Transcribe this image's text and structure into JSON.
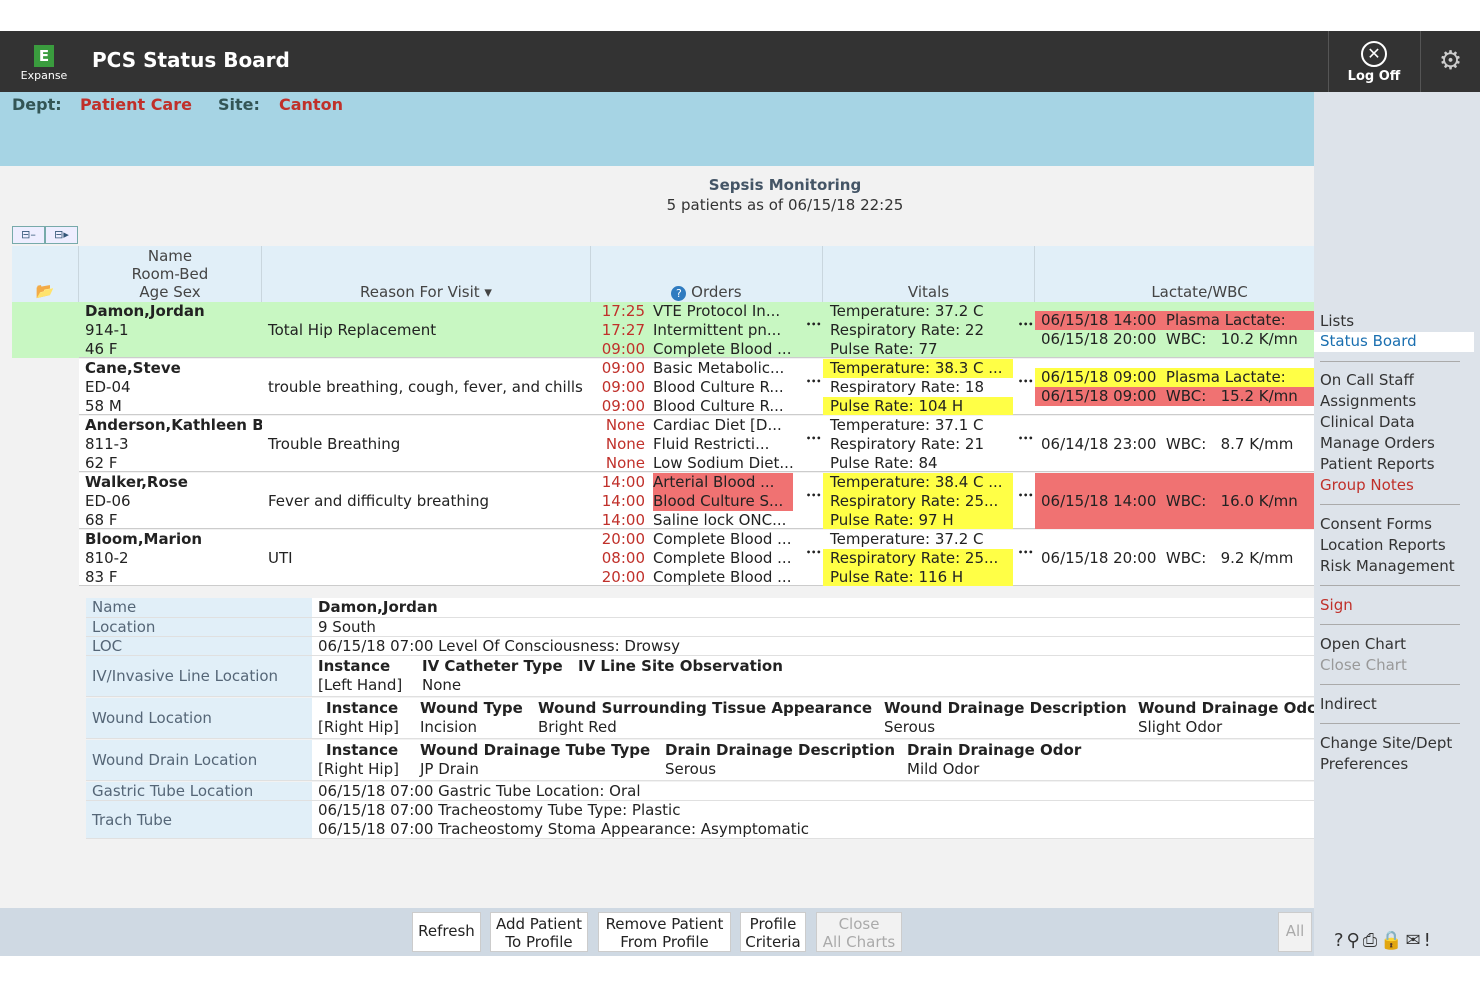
{
  "app": {
    "logo_label": "Expanse",
    "logo_letter": "E",
    "title": "PCS Status Board",
    "logoff_label": "Log Off"
  },
  "dept": {
    "dept_label": "Dept:",
    "dept_value": "Patient Care",
    "site_label": "Site:",
    "site_value": "Canton"
  },
  "board": {
    "title": "Sepsis Monitoring",
    "subtitle": "5 patients as of 06/15/18 22:25"
  },
  "columns": {
    "name_l1": "Name",
    "name_l2": "Room-Bed",
    "name_l3": "Age Sex",
    "reason": "Reason For Visit",
    "orders": "Orders",
    "vitals": "Vitals",
    "lactate": "Lactate/WBC"
  },
  "patients": [
    {
      "name": "Damon,Jordan",
      "room": "914-1",
      "agesex": "46 F",
      "reason": "Total Hip Replacement",
      "orders": [
        {
          "t": "17:25",
          "o": "VTE Protocol In..."
        },
        {
          "t": "17:27",
          "o": "Intermittent pn..."
        },
        {
          "t": "09:00",
          "o": "Complete Blood ..."
        }
      ],
      "vitals": [
        "Temperature: 37.2 C",
        "Respiratory Rate: 22",
        "Pulse Rate: 77"
      ],
      "labs": [
        "06/15/18 14:00  Plasma Lactate:",
        "06/15/18 20:00  WBC:   10.2 K/mn"
      ]
    },
    {
      "name": "Cane,Steve",
      "room": "ED-04",
      "agesex": "58 M",
      "reason": "trouble breathing, cough, fever, and chills",
      "orders": [
        {
          "t": "09:00",
          "o": "Basic Metabolic..."
        },
        {
          "t": "09:00",
          "o": "Blood Culture R..."
        },
        {
          "t": "09:00",
          "o": "Blood Culture R..."
        }
      ],
      "vitals": [
        "Temperature: 38.3 C ...",
        "Respiratory Rate: 18",
        "Pulse Rate: 104 H"
      ],
      "labs": [
        "06/15/18 09:00  Plasma Lactate:",
        "06/15/18 09:00  WBC:   15.2 K/mn"
      ]
    },
    {
      "name": "Anderson,Kathleen B",
      "room": "811-3",
      "agesex": "62 F",
      "reason": "Trouble Breathing",
      "orders": [
        {
          "t": "None",
          "o": "Cardiac Diet [D..."
        },
        {
          "t": "None",
          "o": "Fluid Restricti..."
        },
        {
          "t": "None",
          "o": "Low Sodium Diet..."
        }
      ],
      "vitals": [
        "Temperature: 37.1 C",
        "Respiratory Rate: 21",
        "Pulse Rate: 84"
      ],
      "labs": [
        "06/14/18 23:00  WBC:   8.7 K/mm"
      ]
    },
    {
      "name": "Walker,Rose",
      "room": "ED-06",
      "agesex": "68 F",
      "reason": "Fever and difficulty breathing",
      "orders": [
        {
          "t": "14:00",
          "o": "Arterial Blood ..."
        },
        {
          "t": "14:00",
          "o": "Blood Culture S..."
        },
        {
          "t": "14:00",
          "o": "Saline lock ONC..."
        }
      ],
      "vitals": [
        "Temperature: 38.4 C ...",
        "Respiratory Rate: 25...",
        "Pulse Rate: 97 H"
      ],
      "labs": [
        "06/15/18 14:00  WBC:   16.0 K/mn"
      ]
    },
    {
      "name": "Bloom,Marion",
      "room": "810-2",
      "agesex": "83 F",
      "reason": "UTI",
      "orders": [
        {
          "t": "20:00",
          "o": "Complete Blood ..."
        },
        {
          "t": "08:00",
          "o": "Complete Blood ..."
        },
        {
          "t": "20:00",
          "o": "Complete Blood ..."
        }
      ],
      "vitals": [
        "Temperature: 37.2 C",
        "Respiratory Rate: 25...",
        "Pulse Rate: 116 H"
      ],
      "labs": [
        "06/15/18 20:00  WBC:   9.2 K/mm"
      ]
    }
  ],
  "detail": {
    "name_label": "Name",
    "name_value": "Damon,Jordan",
    "location_label": "Location",
    "location_value": "9 South",
    "loc_label": "LOC",
    "loc_value": "06/15/18 07:00  Level Of Consciousness:  Drowsy",
    "iv_label": "IV/Invasive Line Location",
    "iv_h1": "Instance",
    "iv_h2": "IV Catheter Type",
    "iv_h3": "IV Line Site Observation",
    "iv_v1": "[Left Hand]",
    "iv_v2": "None",
    "wound_label": "Wound Location",
    "w_h1": "Instance",
    "w_h2": "Wound Type",
    "w_h3": "Wound Surrounding Tissue Appearance",
    "w_h4": "Wound Drainage Description",
    "w_h5": "Wound Drainage Odc",
    "w_v1": "[Right Hip]",
    "w_v2": "Incision",
    "w_v3": "Bright Red",
    "w_v4": "Serous",
    "w_v5": "Slight Odor",
    "drain_label": "Wound Drain Location",
    "d_h1": "Instance",
    "d_h2": "Wound Drainage Tube Type",
    "d_h3": "Drain Drainage Description",
    "d_h4": "Drain Drainage Odor",
    "d_v1": "[Right Hip]",
    "d_v2": "JP Drain",
    "d_v3": "Serous",
    "d_v4": "Mild Odor",
    "gastric_label": "Gastric Tube Location",
    "gastric_value": "06/15/18 07:00  Gastric Tube Location:  Oral",
    "trach_label": "Trach Tube",
    "trach_v1": "06/15/18 07:00  Tracheostomy Tube Type:  Plastic",
    "trach_v2": "06/15/18 07:00  Tracheostomy Stoma Appearance:  Asymptomatic"
  },
  "buttons": {
    "refresh": "Refresh",
    "add1": "Add Patient",
    "add2": "To Profile",
    "rem1": "Remove Patient",
    "rem2": "From Profile",
    "prof1": "Profile",
    "prof2": "Criteria",
    "close1": "Close",
    "close2": "All Charts",
    "all": "All"
  },
  "sidebar": {
    "lists": "Lists",
    "status_board": "Status Board",
    "on_call": "On Call Staff",
    "assignments": "Assignments",
    "clinical": "Clinical Data",
    "manage_orders": "Manage Orders",
    "patient_reports": "Patient Reports",
    "group_notes": "Group Notes",
    "consent": "Consent Forms",
    "location_reports": "Location Reports",
    "risk": "Risk Management",
    "sign": "Sign",
    "open_chart": "Open Chart",
    "close_chart": "Close Chart",
    "indirect": "Indirect",
    "change_site": "Change Site/Dept",
    "preferences": "Preferences",
    "footer_icons": "?⚲⎙🔒✉!"
  }
}
